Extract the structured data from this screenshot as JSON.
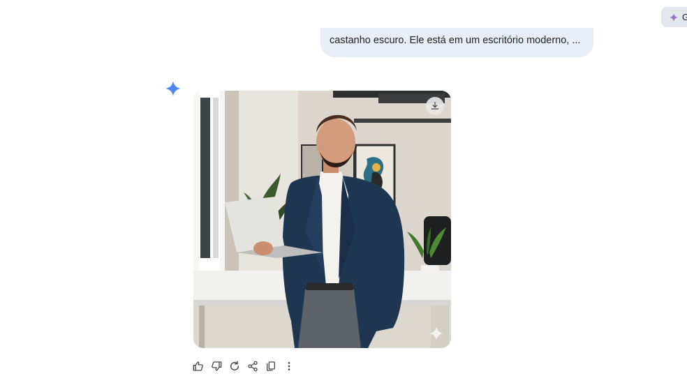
{
  "top_chip": {
    "label": "G",
    "icon": "gemini-spark-icon"
  },
  "conversation": {
    "user_prompt": "castanho escuro. Ele está em um escritório moderno, ..."
  },
  "response": {
    "icon": "gemini-spark-icon",
    "image": {
      "download_icon": "download-icon",
      "watermark_icon": "spark-watermark-icon"
    },
    "actions": [
      {
        "name": "thumbs-up-icon"
      },
      {
        "name": "thumbs-down-icon"
      },
      {
        "name": "regenerate-icon"
      },
      {
        "name": "share-icon"
      },
      {
        "name": "copy-icon"
      },
      {
        "name": "more-vert-icon"
      }
    ]
  },
  "colors": {
    "bubble_bg": "#e9eef6",
    "spark_blue": "#4285f4",
    "icon_gray": "#444746"
  }
}
